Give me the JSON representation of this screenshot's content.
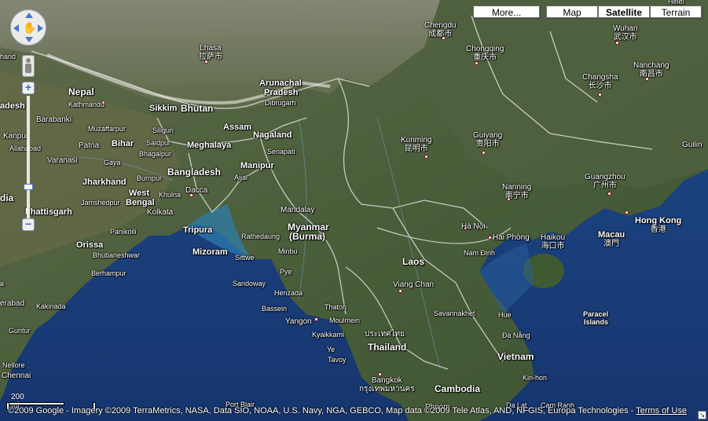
{
  "map_types": {
    "more": "More...",
    "map": "Map",
    "satellite": "Satellite",
    "terrain": "Terrain",
    "active": "Satellite"
  },
  "controls": {
    "zoom_in": "+",
    "zoom_out": "−"
  },
  "scale": {
    "label": "200 mi"
  },
  "attribution": {
    "text": "©2009 Google - Imagery ©2009 TerraMetrics, NASA, Data SIO, NOAA, U.S. Navy, NGA, GEBCO, Map data ©2009 Tele Atlas, AND, NFGIS, Europa Technologies - ",
    "terms": "Terms of Use"
  },
  "labels": {
    "helei": "Helei",
    "chengdu": "Chengdu",
    "chengdu_cn": "成都市",
    "wuhan": "Wuhan",
    "wuhan_cn": "武汉市",
    "lhasa": "Lhasa",
    "lhasa_cn": "拉萨市",
    "chongqing": "Chongqing",
    "chongqing_cn": "重庆市",
    "nanchang": "Nanchang",
    "nanchang_cn": "南昌市",
    "changsha": "Changsha",
    "changsha_cn": "长沙市",
    "hand": "hand",
    "nepal": "Nepal",
    "kathmandu": "Kathmandu",
    "arunachal": "Arunachal",
    "pradesh": "Pradesh",
    "dibrugarh": "Dibrugarh",
    "adesh": "adesh",
    "sikkim": "Sikkim",
    "bhutan": "Bhutan",
    "barabanki": "Barabanki",
    "muzaffarpur": "Muzaffarpur",
    "siliguri": "Siliguri",
    "assam": "Assam",
    "kanpur": "Kanpur",
    "allahabad": "Allahabad",
    "patna": "Patna",
    "bihar": "Bihar",
    "saidpur": "Saidpur",
    "meghalaya": "Meghalaya",
    "nagaland": "Nagaland",
    "kunming": "Kunming",
    "kunming_cn": "昆明市",
    "guiyang": "Guiyang",
    "guiyang_cn": "贵阳市",
    "guilin": "Guilin",
    "varanasi": "Varanasi",
    "gaya": "Gaya",
    "bhagalpur": "Bhagalpur",
    "senapati": "Senapati",
    "bangladesh": "Bangladesh",
    "manipur": "Manipur",
    "jharkhand": "Jharkhand",
    "burnpur": "Burnpur",
    "aijal": "Aijal",
    "dacca": "Dacca",
    "west": "West",
    "bengal": "Bengal",
    "khulna": "Khulna",
    "jamshedpur": "Jamshedpur",
    "dia": "dia",
    "nanning": "Nanning",
    "nanning_cn": "南宁市",
    "guangzhou": "Guangzhou",
    "guangzhou_cn": "广州市",
    "chhattisgarh": "hhattisgarh",
    "kolkata": "Kolkata",
    "mandalay": "Mandalay",
    "myanmar": "Myanmar",
    "burma": "(Burma)",
    "hongkong": "Hong Kong",
    "hongkong_cn": "香港",
    "tripura": "Tripura",
    "rathedaung": "Rathedaung",
    "panikoili": "Panikoili",
    "ha_noi": "Hà Nội",
    "hai_phong": "Hai Phòng",
    "haikou": "Haikou",
    "haikou_cn": "海口市",
    "macau": "Macau",
    "macau_cn": "澳門",
    "orissa": "Orissa",
    "bhubaneshwar": "Bhubaneshwar",
    "mizoram": "Mizoram",
    "sittwe": "Sittwe",
    "minbu": "Minbu",
    "laos": "Laos",
    "nam_dinh": "Nam Định",
    "berhampur": "Berhampur",
    "pye": "Pye",
    "sandoway": "Sandoway",
    "viang_chan": "Viang Chan",
    "henzada": "Henzada",
    "a": "a",
    "erabad": "erabad",
    "kakinada": "Kakinada",
    "bassein": "Bassein",
    "thaton": "Thaton",
    "savannakhet": "Savannakhet",
    "moulmein": "Moulmein",
    "yangon": "Yangon",
    "hue": "Hue",
    "paracel": "Paracel",
    "islands": "Islands",
    "guntur": "Guntur",
    "kyaikkami": "Kyaikkami",
    "thailand_th": "ประเทศไทย",
    "thailand": "Thailand",
    "da_nang": "Đà Nẵng",
    "ye": "Ye",
    "tavoy": "Tavoy",
    "vietnam": "Vietnam",
    "nellore": "Nellore",
    "chennai": "Chennai",
    "bangkok": "Bangkok",
    "bangkok_th": "กรุงเทพมหานคร",
    "kin_hon": "Kin-hon",
    "cambodia": "Cambodia",
    "port_blair": "Port Blair",
    "phnom": "Phnom",
    "da_lat": "Da Lat",
    "cam_ranh": "Cam Ranh"
  }
}
